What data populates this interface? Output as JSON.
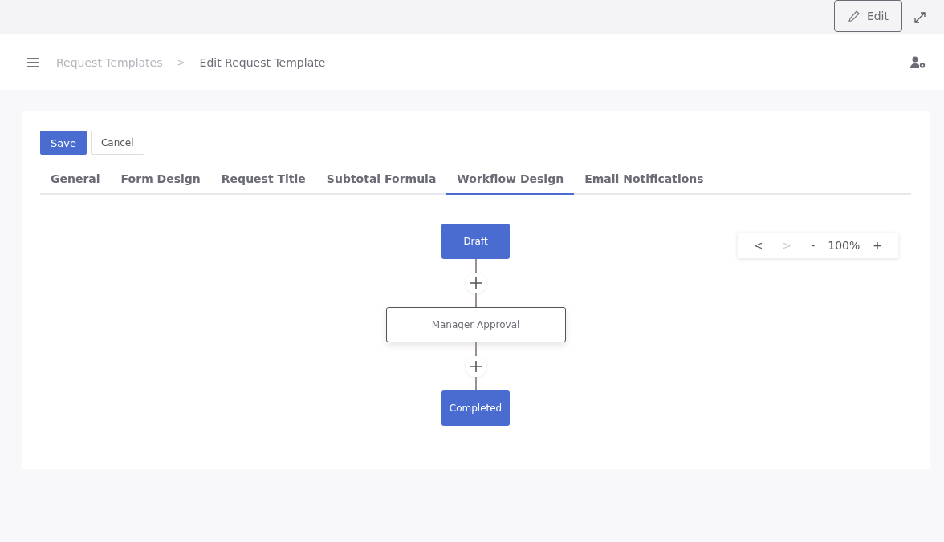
{
  "topbar": {
    "edit_button": "Edit"
  },
  "header": {
    "breadcrumbs": [
      {
        "label": "Request Templates",
        "current": false
      },
      {
        "label": "Edit Request Template",
        "current": true
      }
    ],
    "separator": ">"
  },
  "actions": {
    "save": "Save",
    "cancel": "Cancel"
  },
  "tabs": [
    {
      "label": "General",
      "selected": false
    },
    {
      "label": "Form Design",
      "selected": false
    },
    {
      "label": "Request Title",
      "selected": false
    },
    {
      "label": "Subtotal Formula",
      "selected": false
    },
    {
      "label": "Workflow Design",
      "selected": true
    },
    {
      "label": "Email Notifications",
      "selected": false
    }
  ],
  "workflow": {
    "nodes": [
      {
        "label": "Draft",
        "kind": "status"
      },
      {
        "label": "Manager Approval",
        "kind": "step"
      },
      {
        "label": "Completed",
        "kind": "status"
      }
    ]
  },
  "zoom_controls": {
    "prev": {
      "label": "<",
      "disabled": false
    },
    "next": {
      "label": ">",
      "disabled": true
    },
    "zoom_out": "-",
    "level": "100%",
    "zoom_in": "+"
  }
}
